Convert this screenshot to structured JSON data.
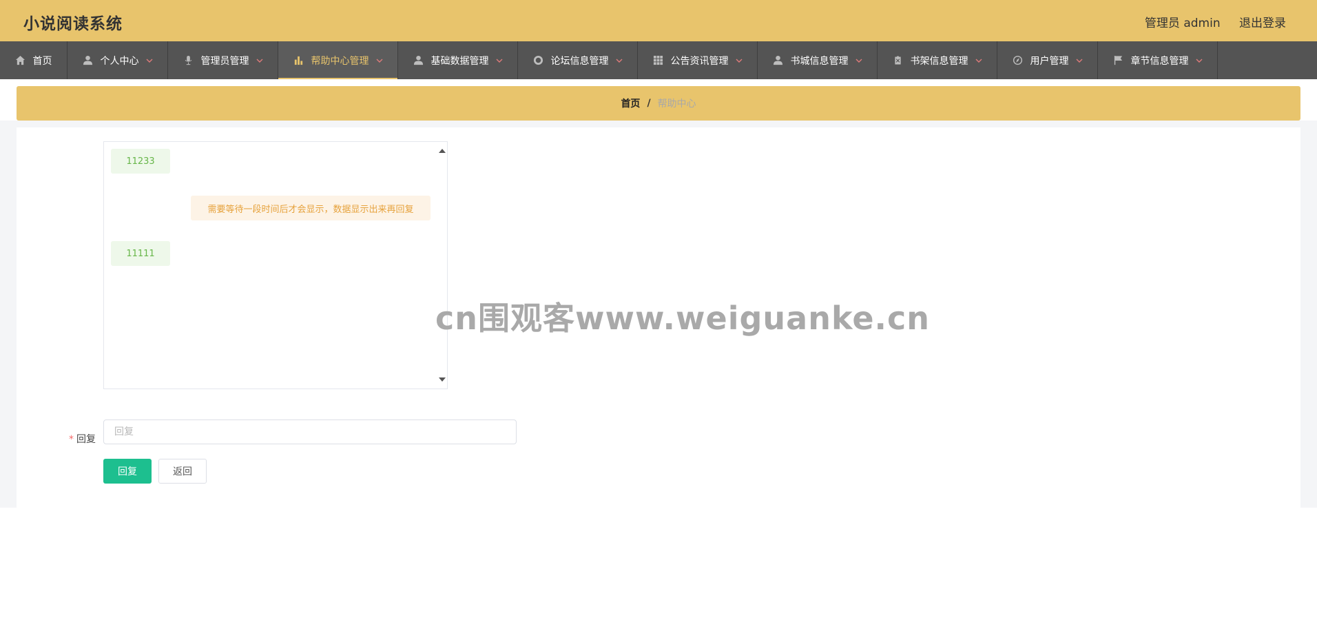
{
  "app": {
    "title": "小说阅读系统"
  },
  "user": {
    "greeting": "管理员 admin",
    "logout": "退出登录"
  },
  "nav": {
    "items": [
      {
        "label": "首页",
        "icon": "home-icon",
        "active": false,
        "dropdown": false
      },
      {
        "label": "个人中心",
        "icon": "user-icon",
        "active": false,
        "dropdown": true
      },
      {
        "label": "管理员管理",
        "icon": "microphone-icon",
        "active": false,
        "dropdown": true
      },
      {
        "label": "帮助中心管理",
        "icon": "bar-chart-icon",
        "active": true,
        "dropdown": true
      },
      {
        "label": "基础数据管理",
        "icon": "user-icon",
        "active": false,
        "dropdown": true
      },
      {
        "label": "论坛信息管理",
        "icon": "lifebuoy-icon",
        "active": false,
        "dropdown": true
      },
      {
        "label": "公告资讯管理",
        "icon": "grid-icon",
        "active": false,
        "dropdown": true
      },
      {
        "label": "书城信息管理",
        "icon": "user-icon",
        "active": false,
        "dropdown": true
      },
      {
        "label": "书架信息管理",
        "icon": "clipboard-icon",
        "active": false,
        "dropdown": true
      },
      {
        "label": "用户管理",
        "icon": "compass-icon",
        "active": false,
        "dropdown": true
      },
      {
        "label": "章节信息管理",
        "icon": "flag-icon",
        "active": false,
        "dropdown": true
      }
    ]
  },
  "breadcrumb": {
    "home": "首页",
    "separator": "/",
    "current": "帮助中心"
  },
  "chat": {
    "messages": [
      {
        "side": "left",
        "text": "11233"
      },
      {
        "side": "right",
        "text": "需要等待一段时间后才会显示，数据显示出来再回复"
      },
      {
        "side": "left",
        "text": "11111"
      }
    ]
  },
  "form": {
    "reply_label": "回复",
    "required_mark": "*",
    "reply_placeholder": "回复",
    "reply_value": ""
  },
  "buttons": {
    "submit": "回复",
    "back": "返回"
  },
  "watermark": {
    "text": "cn围观客www.weiguanke.cn"
  },
  "colors": {
    "accent": "#e8c46c",
    "nav_bg": "#545454",
    "primary_button": "#1dbf8f",
    "left_msg_bg": "#eef8ea",
    "right_msg_bg": "#fdf3e6"
  }
}
